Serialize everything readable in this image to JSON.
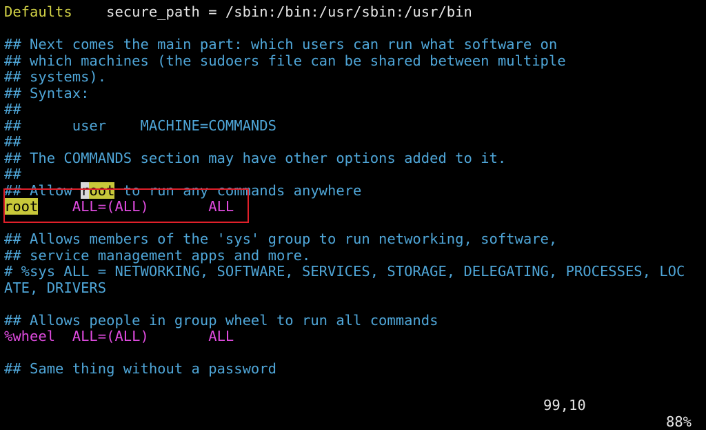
{
  "editor": {
    "lines": [
      {
        "kw": "Defaults",
        "rest": "    secure_path = /sbin:/bin:/usr/sbin:/usr/bin"
      },
      {
        "text": ""
      },
      {
        "text": "## Next comes the main part: which users can run what software on"
      },
      {
        "text": "## which machines (the sudoers file can be shared between multiple"
      },
      {
        "text": "## systems)."
      },
      {
        "text": "## Syntax:"
      },
      {
        "text": "##"
      },
      {
        "text": "##      user    MACHINE=COMMANDS"
      },
      {
        "text": "##"
      },
      {
        "text": "## The COMMANDS section may have other options added to it."
      },
      {
        "text": "##"
      },
      {
        "pre": "## Allow ",
        "cursor_char": "r",
        "match_rest": "oot",
        "post": " to run any commands anywhere"
      },
      {
        "user": "root",
        "gap": "    ",
        "spec": "ALL=(ALL)",
        "gap2": "       ",
        "cmd": "ALL"
      },
      {
        "text": ""
      },
      {
        "text": "## Allows members of the 'sys' group to run networking, software,"
      },
      {
        "text": "## service management apps and more."
      },
      {
        "text": "# %sys ALL = NETWORKING, SOFTWARE, SERVICES, STORAGE, DELEGATING, PROCESSES, LOC"
      },
      {
        "text": "ATE, DRIVERS"
      },
      {
        "text": ""
      },
      {
        "text": "## Allows people in group wheel to run all commands"
      },
      {
        "user": "%wheel",
        "gap": "  ",
        "spec": "ALL=(ALL)",
        "gap2": "       ",
        "cmd": "ALL"
      },
      {
        "text": ""
      },
      {
        "text": "## Same thing without a password"
      }
    ]
  },
  "status": {
    "position": "99,10",
    "percent": "88%"
  },
  "colors": {
    "background": "#000000",
    "comment": "#4fa6d8",
    "keyword": "#d2d246",
    "spec": "#e04be0",
    "search_highlight": "#c8c83a",
    "annotation_box": "#e0202a"
  }
}
